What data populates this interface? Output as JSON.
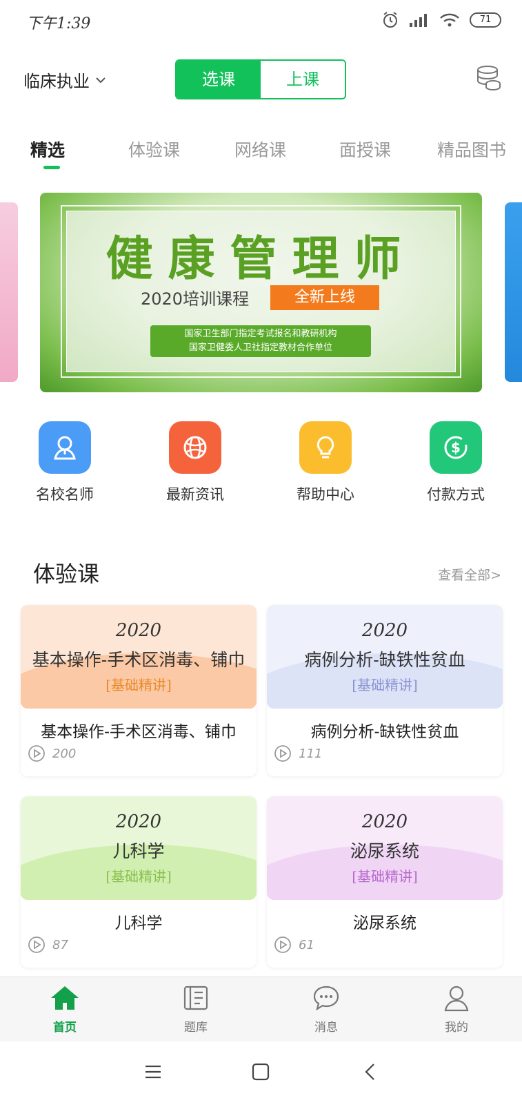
{
  "status_bar": {
    "time": "下午1:39",
    "battery": "71"
  },
  "header": {
    "exam_type": "临床执业",
    "segment": {
      "left": "选课",
      "right": "上课"
    }
  },
  "tabs": [
    "精选",
    "体验课",
    "网络课",
    "面授课",
    "精品图书"
  ],
  "banner": {
    "title": "健康管理师",
    "subtitle": "2020培训课程",
    "badge": "全新上线",
    "line1": "国家卫生部门指定考试报名和教研机构",
    "line2": "国家卫健委人卫社指定教材合作单位"
  },
  "quick_menu": [
    {
      "label": "名校名师",
      "icon": "teacher-icon",
      "color": "#4a9cf7"
    },
    {
      "label": "最新资讯",
      "icon": "globe-icon",
      "color": "#f5633d"
    },
    {
      "label": "帮助中心",
      "icon": "lightbulb-icon",
      "color": "#fbbd2d"
    },
    {
      "label": "付款方式",
      "icon": "payment-icon",
      "color": "#22c77a"
    }
  ],
  "section": {
    "title": "体验课",
    "more": "查看全部>"
  },
  "courses": [
    {
      "year": "2020",
      "cover_name": "基本操作-手术区消毒、铺巾",
      "tag": "[基础精讲]",
      "title": "基本操作-手术区消毒、铺巾",
      "count": "200",
      "bg": "#fde6d5",
      "wave": "#fbc9a5",
      "tag_color": "#e98a2a"
    },
    {
      "year": "2020",
      "cover_name": "病例分析-缺铁性贫血",
      "tag": "[基础精讲]",
      "title": "病例分析-缺铁性贫血",
      "count": "111",
      "bg": "#eef1fb",
      "wave": "#dde3f7",
      "tag_color": "#8c93d3"
    },
    {
      "year": "2020",
      "cover_name": "儿科学",
      "tag": "[基础精讲]",
      "title": "儿科学",
      "count": "87",
      "bg": "#e8f7d8",
      "wave": "#d0efb1",
      "tag_color": "#8cbf4e"
    },
    {
      "year": "2020",
      "cover_name": "泌尿系统",
      "tag": "[基础精讲]",
      "title": "泌尿系统",
      "count": "61",
      "bg": "#f9eafa",
      "wave": "#f0d6f4",
      "tag_color": "#b768cf"
    }
  ],
  "bottom_nav": [
    {
      "label": "首页",
      "icon": "home-icon",
      "active": true
    },
    {
      "label": "题库",
      "icon": "question-bank-icon",
      "active": false
    },
    {
      "label": "消息",
      "icon": "message-icon",
      "active": false
    },
    {
      "label": "我的",
      "icon": "profile-icon",
      "active": false
    }
  ],
  "colors": {
    "accent": "#12c15a"
  }
}
